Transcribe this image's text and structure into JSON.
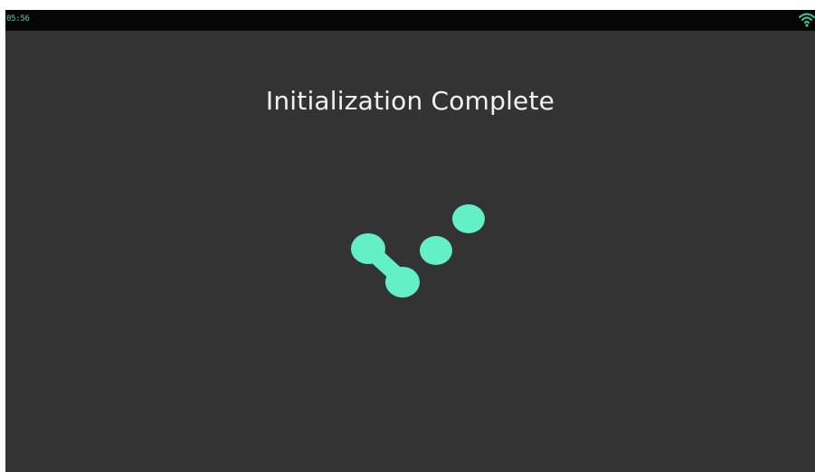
{
  "status_bar": {
    "time": "05:56",
    "wifi_icon": "wifi-icon"
  },
  "main": {
    "title": "Initialization Complete",
    "success_icon": "check-mark-dots-icon"
  },
  "colors": {
    "background": "#333333",
    "status_bar": "#050505",
    "accent": "#63f0c7",
    "title_text": "#f2f2f2"
  }
}
